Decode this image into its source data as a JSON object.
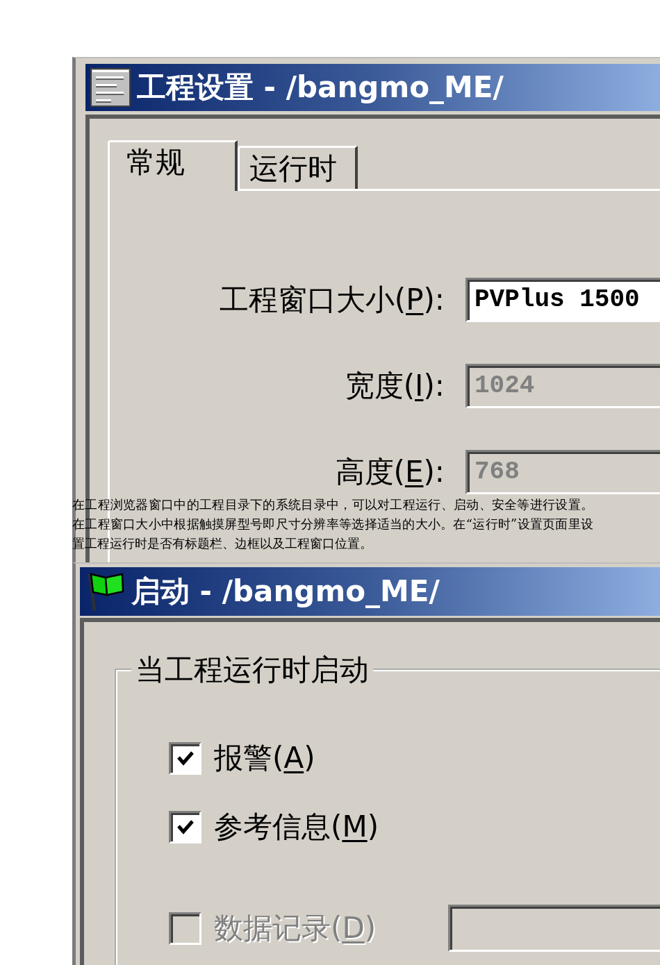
{
  "settings_window": {
    "title": "工程设置 - /bangmo_ME/",
    "tabs": [
      {
        "label": "常规",
        "selected": true
      },
      {
        "label": "运行时",
        "selected": false
      }
    ],
    "fields": [
      {
        "label_before": "工程窗口大小(",
        "access_key": "P",
        "label_after": "):",
        "value": "PVPlus 1500",
        "disabled": false
      },
      {
        "label_before": "宽度(",
        "access_key": "I",
        "label_after": "):",
        "value": "1024",
        "disabled": true
      },
      {
        "label_before": "高度(",
        "access_key": "E",
        "label_after": "):",
        "value": "768",
        "disabled": true
      }
    ]
  },
  "paragraph": "在工程浏览器窗口中的工程目录下的系统目录中，可以对工程运行、启动、安全等进行设置。在工程窗口大小中根据触摸屏型号即尺寸分辨率等选择适当的大小。在“运行时”设置页面里设置工程运行时是否有标题栏、边框以及工程窗口位置。",
  "startup_window": {
    "title": "启动 - /bangmo_ME/",
    "group": {
      "title": "当工程运行时启动",
      "options": [
        {
          "kind": "checkbox",
          "label_before": "报警(",
          "access_key": "A",
          "label_after": ")",
          "checked": true,
          "disabled": false
        },
        {
          "kind": "checkbox",
          "label_before": "参考信息(",
          "access_key": "M",
          "label_after": ")",
          "checked": true,
          "disabled": false
        },
        {
          "kind": "checkbox_field",
          "label_before": "数据记录(",
          "access_key": "D",
          "label_after": ")",
          "checked": false,
          "disabled": true
        }
      ]
    }
  }
}
